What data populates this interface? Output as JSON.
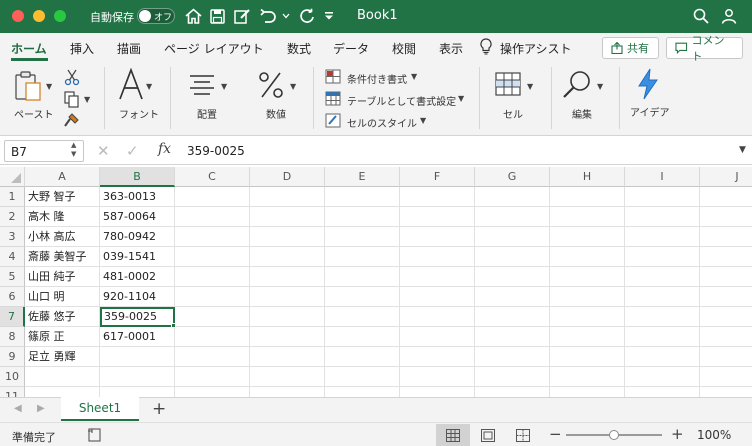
{
  "titlebar": {
    "autosave_label": "自動保存",
    "autosave_state": "オフ",
    "doc_title": "Book1"
  },
  "tabs": [
    {
      "label": "ホーム",
      "active": true
    },
    {
      "label": "挿入"
    },
    {
      "label": "描画"
    },
    {
      "label": "ページ レイアウト"
    },
    {
      "label": "数式"
    },
    {
      "label": "データ"
    },
    {
      "label": "校閲"
    },
    {
      "label": "表示"
    },
    {
      "label": "操作アシスト"
    }
  ],
  "share": {
    "label": "共有"
  },
  "comment": {
    "label": "コメント"
  },
  "ribbon": {
    "paste": "ペースト",
    "font": "フォント",
    "align": "配置",
    "number": "数値",
    "cond_format": "条件付き書式",
    "table_format": "テーブルとして書式設定",
    "cell_style": "セルのスタイル",
    "cells": "セル",
    "edit": "編集",
    "ideas": "アイデア"
  },
  "formula_bar": {
    "name_box": "B7",
    "fx": "fx",
    "formula": "359-0025"
  },
  "grid": {
    "columns": [
      "A",
      "B",
      "C",
      "D",
      "E",
      "F",
      "G",
      "H",
      "I",
      "J"
    ],
    "rows": [
      {
        "num": "1",
        "a": "大野 智子",
        "b": "363-0013"
      },
      {
        "num": "2",
        "a": "高木 隆",
        "b": "587-0064"
      },
      {
        "num": "3",
        "a": "小林 高広",
        "b": "780-0942"
      },
      {
        "num": "4",
        "a": "斎藤 美智子",
        "b": "039-1541"
      },
      {
        "num": "5",
        "a": "山田 純子",
        "b": "481-0002"
      },
      {
        "num": "6",
        "a": "山口 明",
        "b": "920-1104"
      },
      {
        "num": "7",
        "a": "佐藤 悠子",
        "b": "359-0025"
      },
      {
        "num": "8",
        "a": "篠原 正",
        "b": "617-0001"
      },
      {
        "num": "9",
        "a": "足立 勇輝",
        "b": ""
      },
      {
        "num": "10",
        "a": "",
        "b": ""
      },
      {
        "num": "11",
        "a": "",
        "b": ""
      }
    ],
    "active_cell": "B7"
  },
  "sheets": {
    "active": "Sheet1",
    "add": "+"
  },
  "status": {
    "ready": "準備完了",
    "zoom": "100%",
    "zoom_level": 0.5
  },
  "colors": {
    "accent": "#217346"
  }
}
